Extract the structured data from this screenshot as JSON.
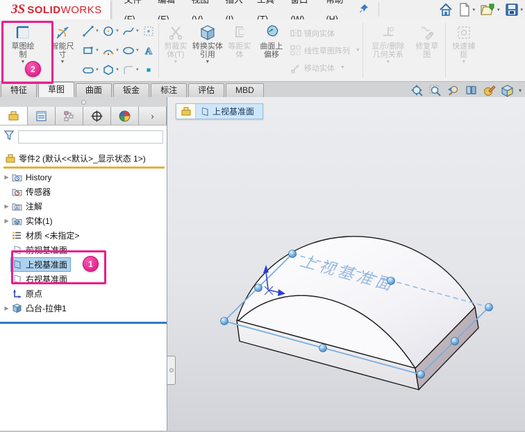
{
  "app": {
    "name": "SOLIDWORKS",
    "logo_ds": "ЗS",
    "logo_solid": "SOLID",
    "logo_works": "WORKS"
  },
  "colors": {
    "accent_magenta": "#ec1d8e",
    "selection_blue": "#add2f0",
    "plane_blue": "#7aaede",
    "logo_red": "#d9232e",
    "rollback_blue": "#2e79c3"
  },
  "menubar": {
    "items": [
      "文件(F)",
      "编辑(E)",
      "视图(V)",
      "插入(I)",
      "工具(T)",
      "窗口(W)",
      "帮助(H)"
    ],
    "icons": [
      "pin-icon",
      "home-icon",
      "new-document-icon",
      "open-icon",
      "save-icon"
    ]
  },
  "ribbon": {
    "sketch": "草图绘制",
    "smart_dimension": "智能尺寸",
    "trim": "剪裁实体(T)",
    "convert": "转换实体引用",
    "offset": "等距实体",
    "surface_offset": "曲面上偏移",
    "mirror": "镜向实体",
    "linear_pattern": "线性草图阵列",
    "move": "移动实体",
    "relations": "显示/删除几何关系",
    "repair": "修复草图",
    "quick_snaps": "快速捕捉",
    "callout": "2",
    "sketch_tool_icons": [
      "line-icon",
      "circle-icon",
      "spline-icon",
      "select-region-icon",
      "rectangle-icon",
      "arc-icon",
      "ellipse-icon",
      "text-icon",
      "slot-icon",
      "polygon-icon",
      "fillet-icon",
      "point-icon"
    ]
  },
  "tabs": [
    "特征",
    "草图",
    "曲面",
    "钣金",
    "标注",
    "评估",
    "MBD"
  ],
  "active_tab": "草图",
  "headsup_icons": [
    "zoom-to-fit",
    "zoom-to-area",
    "previous-view",
    "section-view",
    "edit-appearance",
    "view-orientation"
  ],
  "left_panel": {
    "tab_icons": [
      "featuremanager-tab",
      "propertymanager-tab",
      "configurationmanager-tab",
      "dimxpertmanager-tab",
      "displaymanager-tab"
    ],
    "filter_value": "",
    "callout": "1"
  },
  "feature_tree": {
    "root": "零件2 (默认<<默认>_显示状态 1>)",
    "items": [
      {
        "label": "History"
      },
      {
        "label": "传感器"
      },
      {
        "label": "注解"
      },
      {
        "label": "实体(1)"
      },
      {
        "label": "材质 <未指定>"
      },
      {
        "label": "前视基准面"
      },
      {
        "label": "上视基准面"
      },
      {
        "label": "右视基准面"
      },
      {
        "label": "原点"
      },
      {
        "label": "凸台-拉伸1"
      }
    ],
    "selected_item": "上视基准面"
  },
  "viewport": {
    "breadcrumb_plane": "上视基准面",
    "watermark": "上视基准面"
  }
}
